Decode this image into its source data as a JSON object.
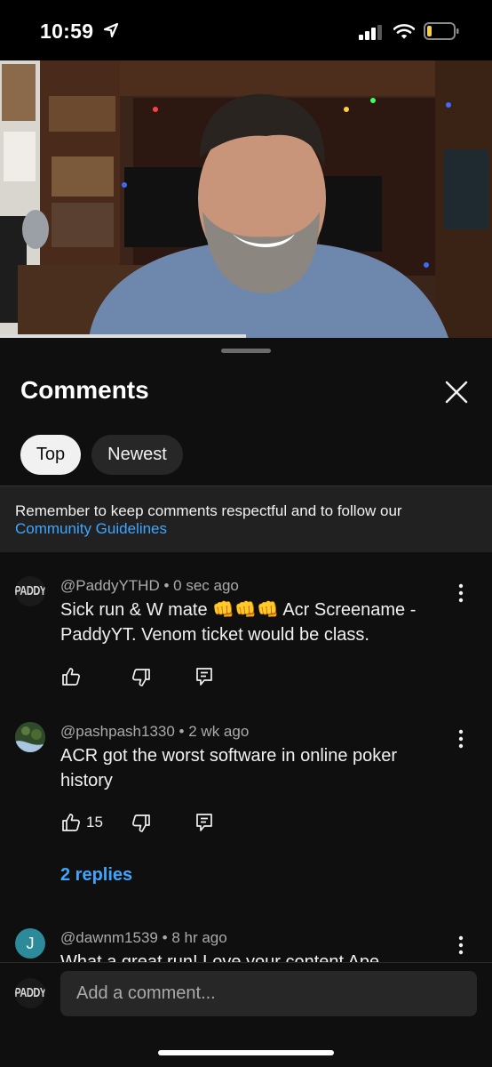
{
  "status_bar": {
    "time": "10:59"
  },
  "comments_panel": {
    "title": "Comments",
    "filters": [
      {
        "label": "Top",
        "selected": true
      },
      {
        "label": "Newest",
        "selected": false
      }
    ],
    "notice": {
      "text": "Remember to keep comments respectful and to follow our",
      "link": "Community Guidelines"
    },
    "comments": [
      {
        "avatar_text": "PADDY",
        "author": "@PaddyYTHD",
        "time": "0 sec ago",
        "text": "Sick run & W mate 👊👊👊 Acr Screename - PaddyYT. Venom ticket would be class.",
        "likes": ""
      },
      {
        "author": "@pashpash1330",
        "time": "2 wk ago",
        "text": "ACR got the worst software in online poker history",
        "likes": "15",
        "replies": "2 replies"
      },
      {
        "avatar_text": "J",
        "author": "@dawnm1539",
        "time": "8 hr ago",
        "text": "What a great run! Love your content Ape"
      }
    ],
    "add_comment": {
      "avatar_text": "PADDY",
      "placeholder": "Add a comment..."
    }
  },
  "colors": {
    "background": "#0f0f0f",
    "link": "#3ea6ff",
    "chip_selected": "#f1f1f1",
    "chip": "#272727"
  }
}
